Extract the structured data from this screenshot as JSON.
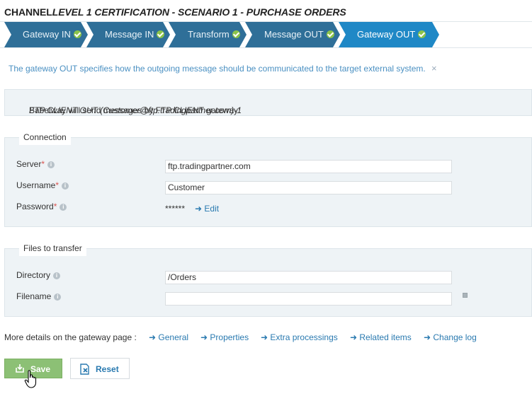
{
  "page": {
    "title_prefix": "CHANNEL",
    "title_italic": "LEVEL 1 CERTIFICATION - SCENARIO 1 - PURCHASE ORDERS"
  },
  "wizard": {
    "steps": [
      {
        "label": "Gateway IN",
        "done": true
      },
      {
        "label": "Message IN",
        "done": true
      },
      {
        "label": "Transform",
        "done": true
      },
      {
        "label": "Message OUT",
        "done": true
      },
      {
        "label": "Gateway OUT",
        "done": true,
        "active": true
      }
    ]
  },
  "info": {
    "text": "The gateway OUT specifies how the outgoing message should be communicated to the target external system.",
    "close": "×"
  },
  "summary": {
    "prefix": "Babelway will send messages by FTP CLIENT gateway:",
    "gateway": "FTP CLIENT OUT (Customer@ftp.tradingpartner.com)-1",
    "suffix": "."
  },
  "connection": {
    "legend": "Connection",
    "server_label": "Server",
    "server_value": "ftp.tradingpartner.com",
    "username_label": "Username",
    "username_value": "Customer",
    "password_label": "Password",
    "password_value": "******",
    "edit_label": "➜ Edit",
    "required_mark": "*",
    "info_glyph": "i"
  },
  "files": {
    "legend": "Files to transfer",
    "directory_label": "Directory",
    "directory_value": "/Orders",
    "filename_label": "Filename",
    "filename_value": ""
  },
  "more_details": {
    "label": "More details on the gateway page :",
    "links": [
      "➜ General",
      "➜ Properties",
      "➜ Extra processings",
      "➜ Related items",
      "➜ Change log"
    ]
  },
  "actions": {
    "save_label": "Save",
    "reset_label": "Reset"
  },
  "colors": {
    "step_done": "#2f6f98",
    "step_active": "#1f88c6",
    "save_green": "#8cc075",
    "link_blue": "#2a7ab0"
  }
}
